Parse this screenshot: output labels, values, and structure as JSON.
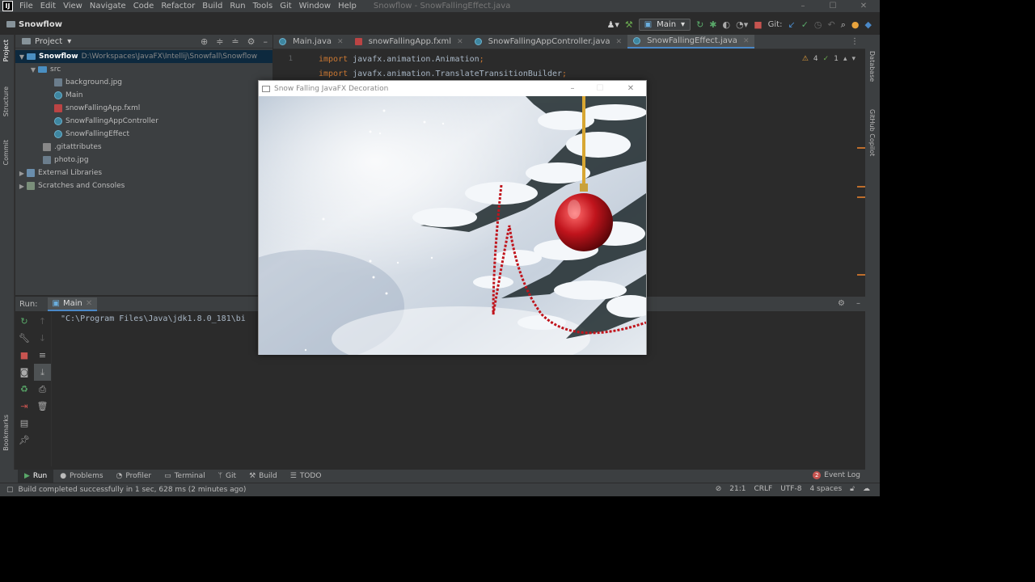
{
  "menubar": {
    "items": [
      "File",
      "Edit",
      "View",
      "Navigate",
      "Code",
      "Refactor",
      "Build",
      "Run",
      "Tools",
      "Git",
      "Window",
      "Help"
    ],
    "window_title": "Snowflow - SnowFallingEffect.java"
  },
  "toolbar": {
    "project_name": "Snowflow",
    "run_config": "Main",
    "git_label": "Git:"
  },
  "project_panel": {
    "title": "Project",
    "tree": [
      {
        "label": "Snowflow",
        "path": "D:\\Workspaces\\JavaFX\\Intellij\\Snowfall\\Snowflow"
      },
      {
        "label": "src"
      },
      {
        "label": "background.jpg"
      },
      {
        "label": "Main"
      },
      {
        "label": "snowFallingApp.fxml"
      },
      {
        "label": "SnowFallingAppController"
      },
      {
        "label": "SnowFallingEffect"
      },
      {
        "label": ".gitattributes"
      },
      {
        "label": "photo.jpg"
      },
      {
        "label": "External Libraries"
      },
      {
        "label": "Scratches and Consoles"
      }
    ]
  },
  "left_strip": {
    "tabs": [
      "Project",
      "Structure",
      "Commit",
      "Bookmarks"
    ]
  },
  "right_strip": {
    "tabs": [
      "Database",
      "GitHub Copilot"
    ]
  },
  "editor": {
    "tabs": [
      "Main.java",
      "snowFallingApp.fxml",
      "SnowFallingAppController.java",
      "SnowFallingEffect.java"
    ],
    "lines": [
      {
        "num": "1",
        "kw": "import",
        "text": "javafx.animation.Animation",
        "end": ";"
      },
      {
        "num": "",
        "kw": "import",
        "text": "javafx.animation.TranslateTransitionBuilder",
        "end": ";"
      }
    ],
    "warnings": "4",
    "weak_warnings": "1"
  },
  "run_panel": {
    "label": "Run:",
    "tab": "Main",
    "console": "\"C:\\Program Files\\Java\\jdk1.8.0_181\\bi"
  },
  "bottom_tabs": [
    "Run",
    "Problems",
    "Profiler",
    "Terminal",
    "Git",
    "Build",
    "TODO"
  ],
  "event_log": {
    "count": "2",
    "label": "Event Log"
  },
  "status": {
    "message": "Build completed successfully in 1 sec, 628 ms (2 minutes ago)",
    "position": "21:1",
    "line_sep": "CRLF",
    "encoding": "UTF-8",
    "indent": "4 spaces"
  },
  "fx_window": {
    "title": "Snow Falling JavaFX Decoration"
  }
}
